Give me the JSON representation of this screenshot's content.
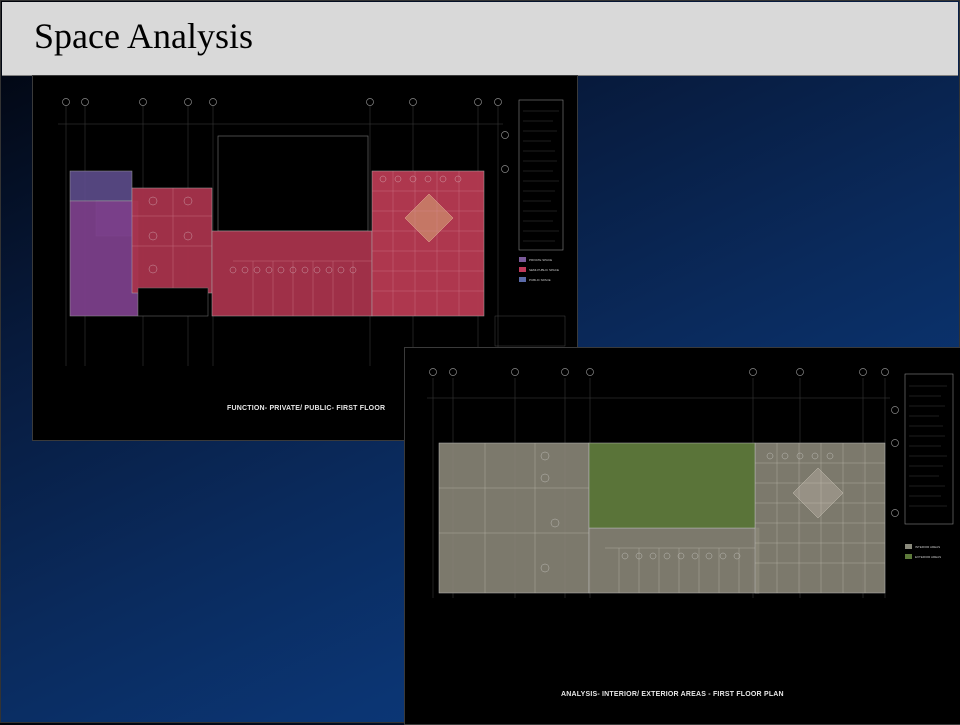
{
  "slide": {
    "title": "Space Analysis"
  },
  "drawings": [
    {
      "caption": "FUNCTION- PRIVATE/ PUBLIC- FIRST FLOOR",
      "legend": [
        {
          "label": "PRIVATE SPACE",
          "color": "#7a5a9a"
        },
        {
          "label": "SEMI-PUBLIC SPACE",
          "color": "#c0395a"
        },
        {
          "label": "PUBLIC SPACE",
          "color": "#5a6aa8"
        }
      ],
      "colors": {
        "private": "#5d4d8c",
        "public": "#b73a52",
        "administrative": "#7b3f8a"
      }
    },
    {
      "caption": "ANALYSIS- INTERIOR/ EXTERIOR AREAS - FIRST FLOOR PLAN",
      "legend": [
        {
          "label": "INTERIOR AREAS",
          "color": "#8a8a7c"
        },
        {
          "label": "EXTERIOR AREAS",
          "color": "#5d7a3a"
        }
      ],
      "colors": {
        "interior": "#8a8678",
        "exterior": "#5f7a3c"
      }
    }
  ]
}
